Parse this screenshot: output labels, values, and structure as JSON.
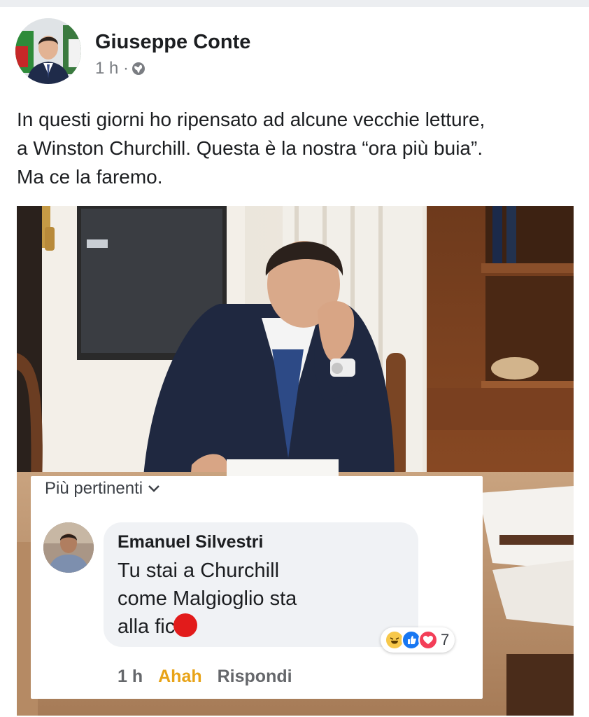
{
  "post": {
    "author": "Giuseppe Conte",
    "time": "1 h ·",
    "text_lines": [
      "In questi giorni ho ripensato ad alcune vecchie letture,",
      "a Winston Churchill. Questa è la nostra “ora più buia”.",
      "Ma ce la faremo."
    ],
    "privacy_icon": "globe-icon"
  },
  "comments": {
    "sort_label": "Più pertinenti",
    "sort_icon": "chevron-down-icon",
    "items": [
      {
        "author": "Emanuel Silvestri",
        "text_lines": [
          "Tu stai a Churchill",
          "come Malgioglio sta",
          "alla fic"
        ],
        "reactions": {
          "icons": [
            "haha-icon",
            "like-icon",
            "love-icon"
          ],
          "count": "7"
        },
        "time": "1 h",
        "reaction_label": "Ahah",
        "reply_label": "Rispondi"
      }
    ]
  },
  "colors": {
    "haha": "#f7c84a",
    "like": "#1877f2",
    "love": "#f33e58",
    "ahah_text": "#e8a317",
    "censor_dot": "#e21b1b"
  }
}
